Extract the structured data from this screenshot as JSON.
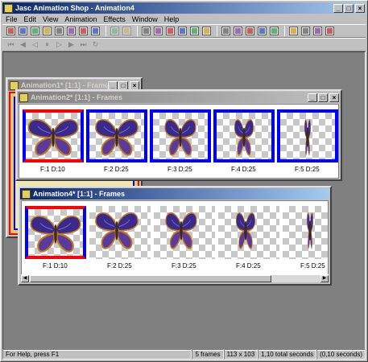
{
  "app": {
    "title": "Jasc Animation Shop - Animation4",
    "window_buttons": [
      "_",
      "□",
      "×"
    ]
  },
  "menu": [
    "File",
    "Edit",
    "View",
    "Animation",
    "Effects",
    "Window",
    "Help"
  ],
  "toolbar1_icons": [
    "wizard-icon",
    "optimize-icon",
    "banner-icon",
    "new-icon",
    "open-icon",
    "save-icon",
    "save-frames-icon",
    "browse-icon",
    "undo-icon",
    "redo-icon",
    "cut-icon",
    "copy-icon",
    "paste-icon",
    "paste-new-icon",
    "paste-after-icon",
    "paste-before-icon",
    "transition-icon",
    "effect-icon",
    "text-icon",
    "propagate-icon",
    "view-icon",
    "frame-props-icon",
    "anim-props-icon",
    "palette-icon",
    "help-icon"
  ],
  "toolbar2_icons": [
    "first-frame-icon",
    "prev-frame-icon",
    "step-back-icon",
    "pause-icon",
    "play-icon",
    "step-forward-icon",
    "last-frame-icon",
    "loop-icon"
  ],
  "windows": [
    {
      "title": "Animation1* [1:1] - Frames",
      "active": false
    },
    {
      "title": "Animation2* [1:1] - Frames",
      "active": false,
      "frames": [
        {
          "label": "F:1  D:10"
        },
        {
          "label": "F:2  D:25"
        },
        {
          "label": "F:3  D:25"
        },
        {
          "label": "F:4  D:25"
        },
        {
          "label": "F:5  D:25"
        }
      ]
    },
    {
      "title": "Animation4* [1:1] - Frames",
      "active": true,
      "frames": [
        {
          "label": "F:1  D:10"
        },
        {
          "label": "F:2  D:25"
        },
        {
          "label": "F:3  D:25"
        },
        {
          "label": "F:4  D:25"
        },
        {
          "label": "F:5  D:25"
        }
      ]
    }
  ],
  "status": {
    "help": "For Help, press F1",
    "frames": "5 frames",
    "size": "113 x 103",
    "time": "1,10 total seconds",
    "time2": "(0,10 seconds)"
  },
  "colors": {
    "selected_border": "#0000ff",
    "current_border": "#ff0000",
    "butterfly_wing": "#3a2a8a",
    "butterfly_edge": "#c07820"
  }
}
